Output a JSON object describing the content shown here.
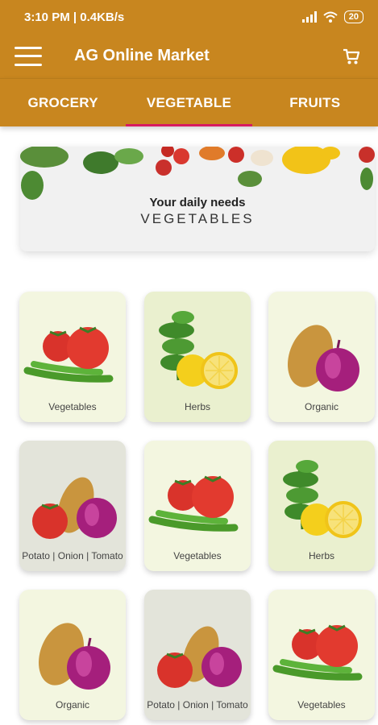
{
  "status": {
    "time": "3:10 PM | 0.4KB/s",
    "battery": "20"
  },
  "appbar": {
    "title": "AG Online Market"
  },
  "tabs": [
    {
      "label": "GROCERY"
    },
    {
      "label": "VEGETABLE"
    },
    {
      "label": "FRUITS"
    }
  ],
  "banner": {
    "line1": "Your daily needs",
    "line2": "VEGETABLES"
  },
  "categories": [
    {
      "label": "Vegetables",
      "image": "tomatoes-chilies"
    },
    {
      "label": "Herbs",
      "image": "herbs-lemon"
    },
    {
      "label": "Organic",
      "image": "potato-onion"
    },
    {
      "label": "Potato | Onion | Tomato",
      "image": "tomato-potato-onion"
    },
    {
      "label": "Vegetables",
      "image": "tomatoes-chilies"
    },
    {
      "label": "Herbs",
      "image": "herbs-lemon"
    },
    {
      "label": "Organic",
      "image": "potato-onion"
    },
    {
      "label": "Potato | Onion | Tomato",
      "image": "tomato-potato-onion"
    },
    {
      "label": "Vegetables",
      "image": "tomatoes-chilies"
    }
  ]
}
